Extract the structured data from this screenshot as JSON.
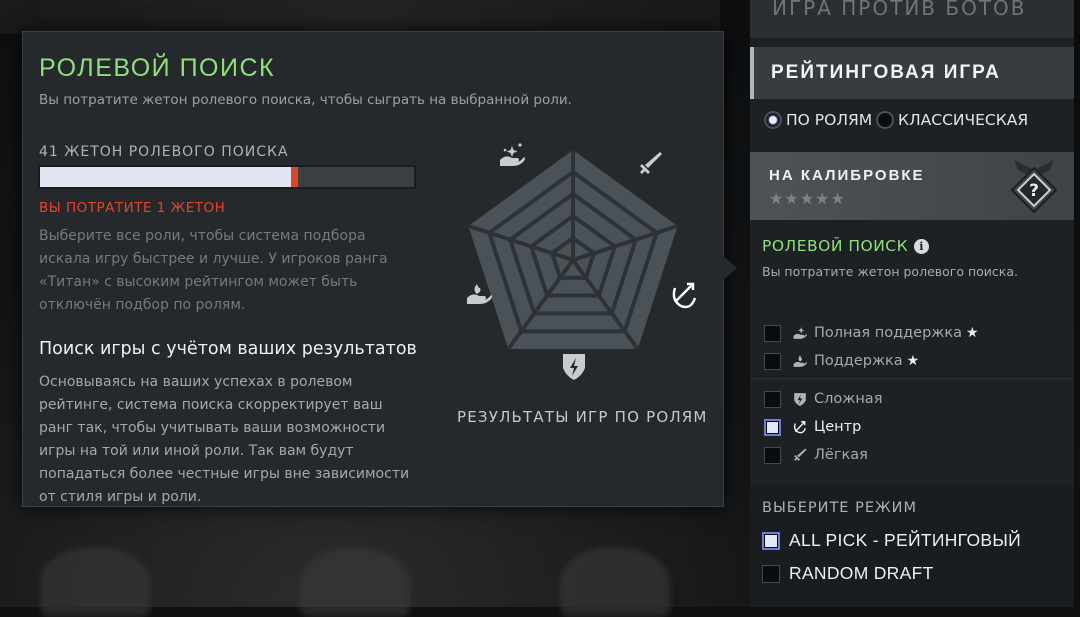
{
  "tooltip": {
    "title": "РОЛЕВОЙ ПОИСК",
    "subtitle": "Вы потратите жетон ролевого поиска, чтобы сыграть на выбранной роли.",
    "token_label": "41 ЖЕТОН РОЛЕВОГО ПОИСКА",
    "token_bar_fraction": 0.68,
    "spend_text": "ВЫ ПОТРАТИТЕ 1 ЖЕТОН",
    "paragraph1": "Выберите все роли, чтобы система подбора искала игру быстрее и лучше. У игроков ранга «Титан» с высоким рейтингом может быть отключён подбор по ролям.",
    "heading": "Поиск игры с учётом ваших результатов",
    "paragraph2": "Основываясь на ваших успехах в ролевом рейтинге, система поиска скорректирует ваш ранг так, чтобы учитывать ваши возможности игры на той или иной роли. Так вам будут попадаться более честные игры вне зависимости от стиля игры и роли.",
    "chart_label": "РЕЗУЛЬТАТЫ ИГР ПО РОЛЯМ",
    "chart_axes_icons": [
      "hand-sparkle-icon",
      "sword-icon",
      "bow-icon",
      "shield-icon",
      "hand-flame-icon"
    ]
  },
  "side": {
    "top_item": "ИГРА ПРОТИВ БОТОВ",
    "header": "РЕЙТИНГОВАЯ ИГРА",
    "mode_options": [
      {
        "label": "ПО РОЛЯМ",
        "selected": true
      },
      {
        "label": "КЛАССИЧЕСКАЯ",
        "selected": false
      }
    ],
    "calibration": {
      "title": "НА КАЛИБРОВКЕ",
      "stars": "★★★★★",
      "medal_symbol": "?"
    },
    "role_search": {
      "title": "РОЛЕВОЙ ПОИСК",
      "info_symbol": "i",
      "subtitle": "Вы потратите жетон ролевого поиска."
    },
    "roles": [
      {
        "label": "Полная поддержка",
        "icon": "hand-sparkle-icon",
        "checked": false,
        "star": "★"
      },
      {
        "label": "Поддержка",
        "icon": "hand-flame-icon",
        "checked": false,
        "star": "★"
      },
      {
        "label": "Сложная",
        "icon": "shield-icon",
        "checked": false,
        "star": ""
      },
      {
        "label": "Центр",
        "icon": "bow-icon",
        "checked": true,
        "star": ""
      },
      {
        "label": "Лёгкая",
        "icon": "sword-icon",
        "checked": false,
        "star": ""
      }
    ],
    "game_mode": {
      "title": "ВЫБЕРИТЕ РЕЖИМ",
      "options": [
        {
          "label": "ALL PICK - РЕЙТИНГОВЫЙ",
          "checked": true
        },
        {
          "label": "RANDOM DRAFT",
          "checked": false
        }
      ]
    }
  }
}
